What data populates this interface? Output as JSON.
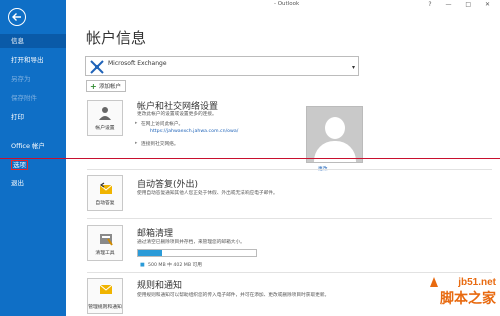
{
  "window": {
    "title": "- Outlook",
    "controls": "? — □ ✕"
  },
  "sidebar": {
    "items": [
      {
        "label": "信息"
      },
      {
        "label": "打开和导出"
      },
      {
        "label": "另存为"
      },
      {
        "label": "保存附件"
      },
      {
        "label": "打印"
      },
      {
        "label": "Office 帐户"
      },
      {
        "label": "选项"
      },
      {
        "label": "退出"
      }
    ]
  },
  "main": {
    "title": "帐户信息",
    "account": {
      "name": "Microsoft Exchange",
      "sub": ""
    },
    "add_account": "添加帐户",
    "sections": [
      {
        "tile": "帐户设置",
        "title": "帐户和社交网络设置",
        "desc": "更改此帐户的设置或设置更多的连接。",
        "bullet1": "在网上访问此帐户。",
        "link": "https://jahwaexch.jahwa.com.cn/owa/",
        "bullet2": "连接到社交网络。"
      },
      {
        "tile": "自动答复",
        "title": "自动答复(外出)",
        "desc": "使用自动答复通知其他人您正处于休假、外出或无法响应电子邮件。"
      },
      {
        "tile": "清理工具",
        "title": "邮箱清理",
        "desc": "通过清空已删除项目并存档，来管理您的邮箱大小。",
        "quota": "500 MB 中 402 MB 可用",
        "progress": 0.2
      },
      {
        "tile": "管理规则和通知",
        "title": "规则和通知",
        "desc1": "使用规则和通知可以帮助组织您的传入电子邮件，并可在添加、更改或删除项目时获取更新。",
        "desc2": ""
      }
    ],
    "photo_link": "更改"
  },
  "watermark": {
    "top": "jb51.net",
    "bottom": "脚本之家"
  }
}
